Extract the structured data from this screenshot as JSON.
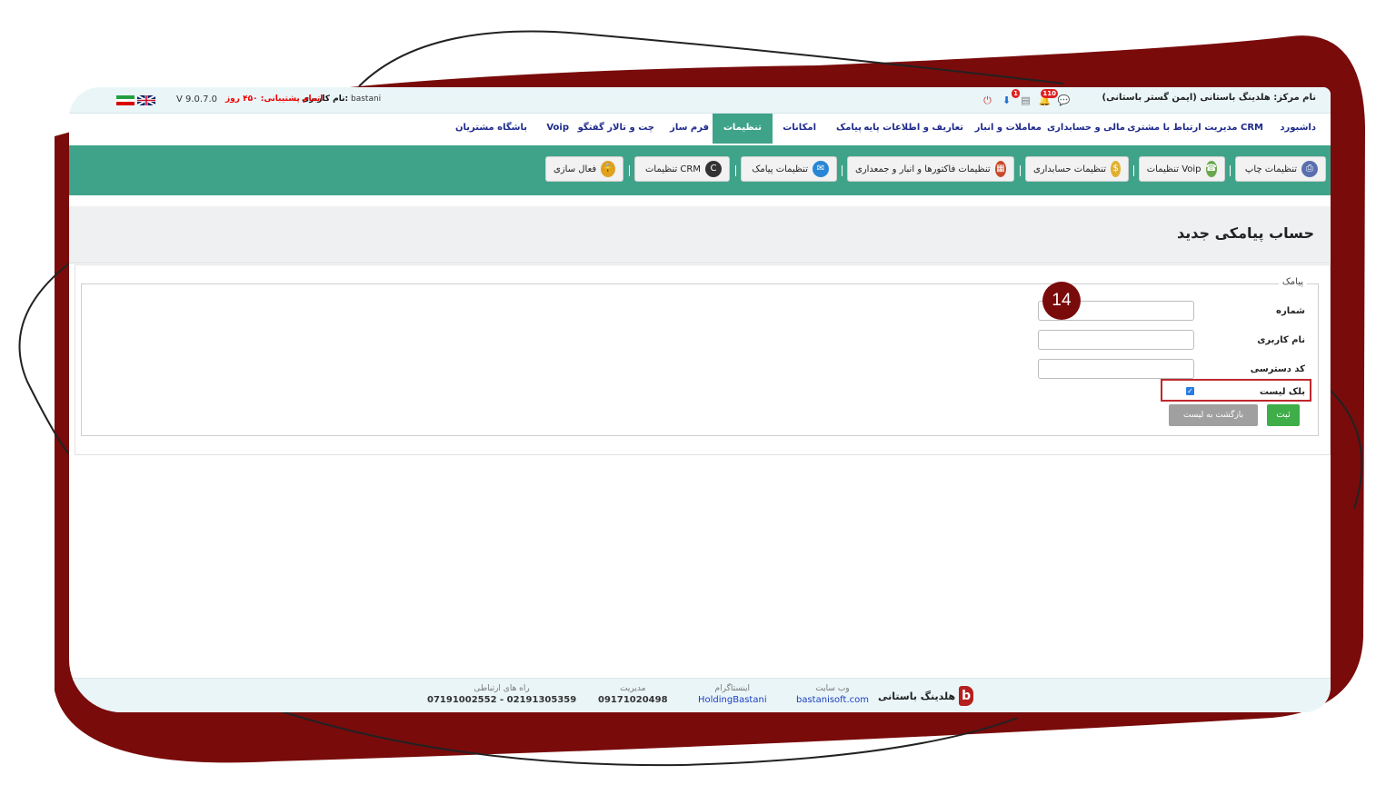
{
  "colors": {
    "frame": "#7a0b0b",
    "accent": "#3fa389",
    "save": "#3fae49",
    "highlight": "#c0282d"
  },
  "topbar": {
    "center_title": "نام مرکز: هلدینگ باستانی (ایمن گستر باستانی)",
    "notification_count": "110",
    "reminder_count": "1",
    "version": "V 9.0.7.0",
    "support_label": "اتمام پشتیبانی:",
    "support_value": "۴۵۰ روز",
    "user_label": "نام کاربری:",
    "user_value": "bastani"
  },
  "menu": {
    "dashboard": "داشبورد",
    "crm": "مدیریت ارتباط با مشتری CRM",
    "finance": "مالی و حسابداری",
    "trade": "معاملات و انبار",
    "definitions": "تعاریف و اطلاعات پایه",
    "sms": "پیامک",
    "features": "امکانات",
    "settings": "تنظیمات",
    "formbuilder": "فرم ساز",
    "chat": "چت و تالار گفتگو",
    "voip": "Voip",
    "club": "باشگاه مشتریان"
  },
  "toolbar": {
    "print": "تنظیمات چاپ",
    "voip": "تنظیمات Voip",
    "accounting": "تنظیمات حسابداری",
    "invoices": "تنظیمات فاکتورها و انبار و جمعداری",
    "sms": "تنظیمات پیامک",
    "crm": "تنظیمات CRM",
    "activation": "فعال سازی"
  },
  "page": {
    "title": "حساب پیامکی جدید",
    "legend": "پیامک",
    "number_label": "شماره",
    "username_label": "نام کاربری",
    "access_label": "کد دسترسی",
    "blacklist_label": "بلک لیست",
    "blacklist_checked": true,
    "save_button": "ثبت",
    "back_button": "بازگشت به لیست"
  },
  "step": "14",
  "footer": {
    "brand": "هلدینگ باستانی",
    "website_label": "وب سایت",
    "website_value": "bastanisoft.com",
    "instagram_label": "اینستاگرام",
    "instagram_value": "HoldingBastani",
    "management_label": "مدیریت",
    "management_value": "09171020498",
    "contact_label": "راه های ارتباطی",
    "contact_value": "07191002552 - 02191305359"
  }
}
